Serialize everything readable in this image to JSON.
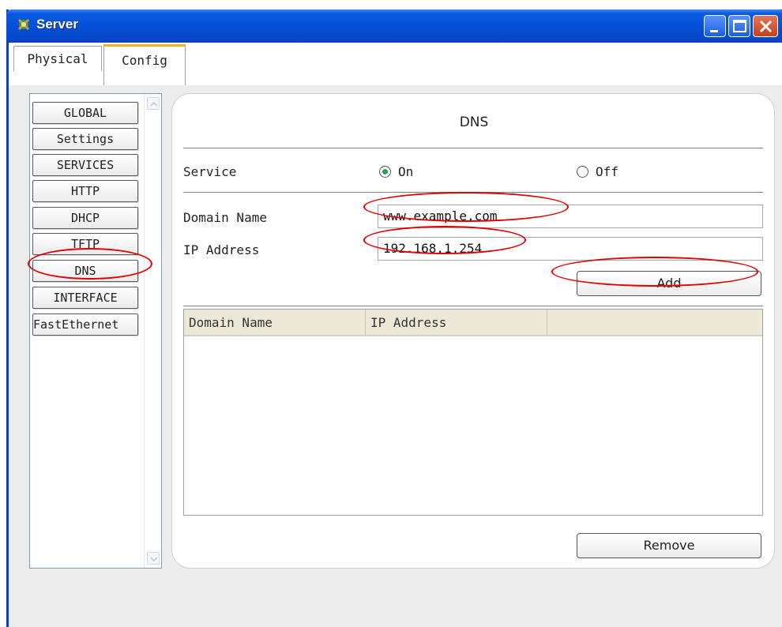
{
  "window": {
    "title": "Server",
    "title_icon": "server-icon"
  },
  "tabs": [
    {
      "label": "Physical",
      "active": false
    },
    {
      "label": "Config",
      "active": true
    }
  ],
  "sidebar": {
    "items": [
      {
        "label": "GLOBAL",
        "kind": "header"
      },
      {
        "label": "Settings",
        "kind": "item"
      },
      {
        "label": "SERVICES",
        "kind": "header"
      },
      {
        "label": "HTTP",
        "kind": "item"
      },
      {
        "label": "DHCP",
        "kind": "item"
      },
      {
        "label": "TFTP",
        "kind": "item"
      },
      {
        "label": "DNS",
        "kind": "item",
        "selected": true
      },
      {
        "label": "INTERFACE",
        "kind": "header"
      },
      {
        "label": "FastEthernet",
        "kind": "item"
      }
    ]
  },
  "dns": {
    "title": "DNS",
    "service_label": "Service",
    "service_on_label": "On",
    "service_off_label": "Off",
    "service_state": "On",
    "domain_name_label": "Domain Name",
    "domain_name_value": "www.example.com",
    "ip_address_label": "IP Address",
    "ip_address_value": "192.168.1.254",
    "add_label": "Add",
    "remove_label": "Remove",
    "table": {
      "columns": [
        "Domain Name",
        "IP Address",
        ""
      ],
      "rows": []
    }
  },
  "colors": {
    "titlebar": "#0450d8",
    "annotation": "#e00000",
    "radio_selected": "#2f9a5a",
    "config_tab_accent": "#f0b030"
  }
}
